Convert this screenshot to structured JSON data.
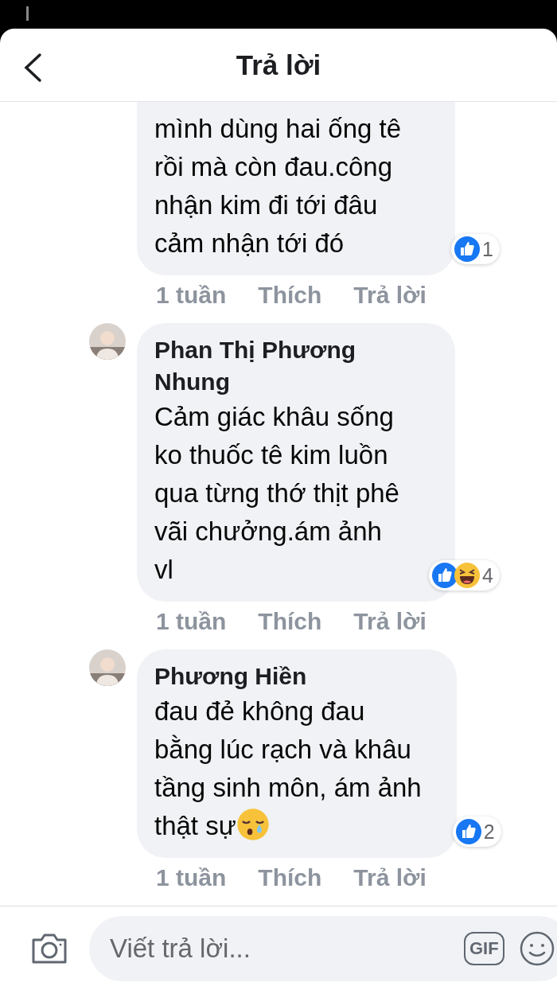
{
  "header": {
    "title": "Trả lời"
  },
  "comments": [
    {
      "cut_top": true,
      "lines": [
        "mình dùng hai ống tê",
        "rồi mà còn đau.công",
        "nhận kim đi tới đâu",
        "cảm nhận tới đó"
      ],
      "reactions": [
        {
          "kind": "like"
        }
      ],
      "count": "1",
      "time": "1 tuần",
      "like": "Thích",
      "reply": "Trả lời"
    },
    {
      "cut_top": false,
      "author": "Phan Thị Phương Nhung",
      "has_avatar": true,
      "lines": [
        "Cảm giác khâu sống",
        "ko thuốc tê kim luồn",
        "qua từng thớ thịt phê",
        "vãi chưởng.ám ảnh",
        "vl"
      ],
      "reactions": [
        {
          "kind": "like"
        },
        {
          "kind": "haha"
        }
      ],
      "count": "4",
      "time": "1 tuần",
      "like": "Thích",
      "reply": "Trả lời"
    },
    {
      "cut_top": false,
      "author": "Phương Hiền",
      "has_avatar": true,
      "lines": [
        "đau đẻ không đau",
        "bằng lúc rạch và khâu",
        "tầng sinh môn, ám ảnh",
        "thật sự"
      ],
      "trailing_emoji": {
        "kind": "sleepy"
      },
      "reactions": [
        {
          "kind": "like"
        }
      ],
      "count": "2",
      "time": "1 tuần",
      "like": "Thích",
      "reply": "Trả lời"
    }
  ],
  "composer": {
    "placeholder": "Viết trả lời...",
    "gif": "GIF"
  }
}
